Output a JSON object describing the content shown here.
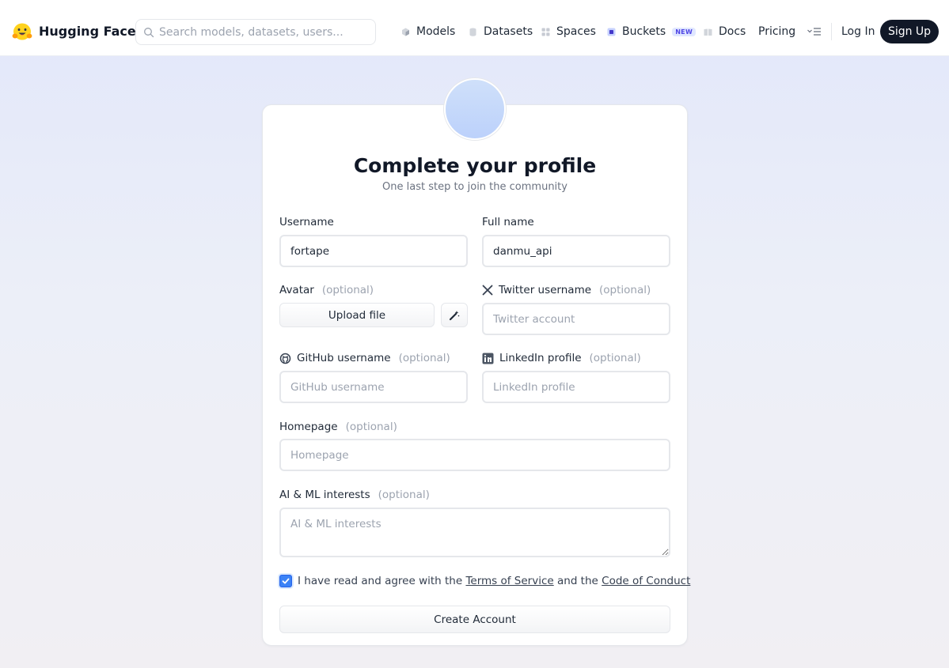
{
  "header": {
    "brand": "Hugging Face",
    "search_placeholder": "Search models, datasets, users...",
    "nav": [
      {
        "label": "Models",
        "icon": "cube-icon"
      },
      {
        "label": "Datasets",
        "icon": "database-icon"
      },
      {
        "label": "Spaces",
        "icon": "grid-icon"
      },
      {
        "label": "Buckets",
        "icon": "bucket-icon",
        "badge": "NEW"
      },
      {
        "label": "Docs",
        "icon": "book-icon"
      },
      {
        "label": "Pricing"
      }
    ],
    "login_label": "Log In",
    "signup_label": "Sign Up"
  },
  "form": {
    "title": "Complete your profile",
    "subtitle": "One last step to join the community",
    "optional_tag": "(optional)",
    "username": {
      "label": "Username",
      "value": "fortape"
    },
    "fullname": {
      "label": "Full name",
      "value": "danmu_api"
    },
    "avatar": {
      "label": "Avatar",
      "upload_label": "Upload file"
    },
    "twitter": {
      "label": "Twitter username",
      "placeholder": "Twitter account"
    },
    "github": {
      "label": "GitHub username",
      "placeholder": "GitHub username"
    },
    "linkedin": {
      "label": "LinkedIn profile",
      "placeholder": "LinkedIn profile"
    },
    "homepage": {
      "label": "Homepage",
      "placeholder": "Homepage"
    },
    "interests": {
      "label": "AI & ML interests",
      "placeholder": "AI & ML interests"
    },
    "agree": {
      "checked": true,
      "text_before": "I have read and agree with the ",
      "terms_link": "Terms of Service",
      "text_middle": " and the ",
      "conduct_link": "Code of Conduct"
    },
    "submit_label": "Create Account"
  },
  "colors": {
    "accent": "#3b82f6",
    "signup_bg": "#111827",
    "badge": "#4f46e5"
  }
}
